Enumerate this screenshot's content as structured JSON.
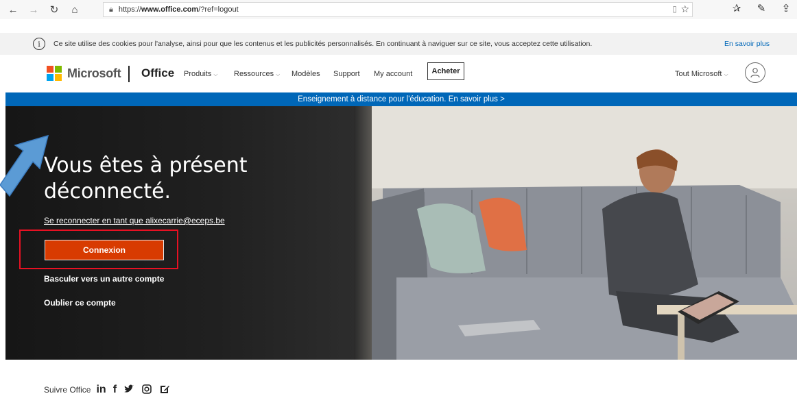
{
  "browser": {
    "url_prefix": "https://",
    "url_domain": "www.office.com",
    "url_path": "/?ref=logout",
    "icons": [
      "back-icon",
      "forward-icon",
      "refresh-icon",
      "home-icon",
      "lock-icon",
      "reading-view-icon",
      "favorite-star-icon",
      "favorites-list-icon",
      "pen-icon",
      "share-icon"
    ]
  },
  "cookie_banner": {
    "text": "Ce site utilise des cookies pour l'analyse, ainsi pour que les contenus et les publicités personnalisés. En continuant à naviguer sur ce site, vous acceptez cette utilisation.",
    "link": "En savoir plus"
  },
  "header": {
    "brand": "Microsoft",
    "product": "Office",
    "nav": [
      {
        "label": "Produits",
        "dropdown": true
      },
      {
        "label": "Ressources",
        "dropdown": true
      },
      {
        "label": "Modèles",
        "dropdown": false
      },
      {
        "label": "Support",
        "dropdown": false
      },
      {
        "label": "My account",
        "dropdown": false
      }
    ],
    "buy_label": "Acheter",
    "all_microsoft": "Tout Microsoft",
    "logo_colors": [
      "#f25022",
      "#7fba00",
      "#00a4ef",
      "#ffb900"
    ]
  },
  "edu_strip": {
    "text": "Enseignement à distance pour l'éducation. En savoir plus >",
    "color": "#0067b8"
  },
  "hero": {
    "title_line1": "Vous êtes à présent",
    "title_line2": "déconnecté.",
    "reconnect_text": "Se reconnecter en tant que alixecarrie@eceps.be",
    "connexion_label": "Connexion",
    "connexion_color": "#d83b01",
    "switch_account": "Basculer vers un autre compte",
    "forget_account": "Oublier ce compte"
  },
  "footer": {
    "follow_label": "Suivre Office",
    "social_icons": [
      "linkedin-icon",
      "facebook-icon",
      "twitter-icon",
      "instagram-icon",
      "blog-icon"
    ]
  }
}
